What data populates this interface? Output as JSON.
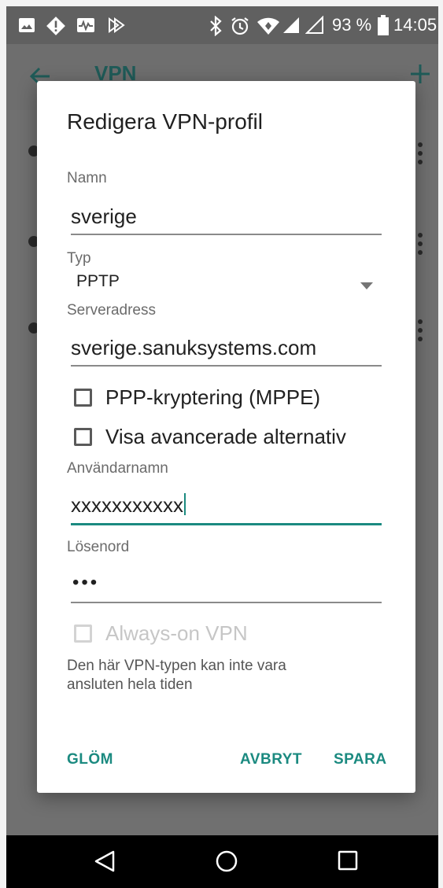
{
  "status_bar": {
    "battery_percent": "93 %",
    "time": "14:05",
    "icons": [
      "image-icon",
      "alert-icon",
      "activity-icon",
      "play-icon",
      "bluetooth-icon",
      "alarm-icon",
      "wifi-icon",
      "signal-icon",
      "signal-empty-icon",
      "battery-icon"
    ]
  },
  "app_bar": {
    "title": "VPN"
  },
  "dialog": {
    "title": "Redigera VPN-profil",
    "name_label": "Namn",
    "name_value": "sverige",
    "type_label": "Typ",
    "type_value": "PPTP",
    "server_label": "Serveradress",
    "server_value": "sverige.sanuksystems.com",
    "mppe_label": "PPP-kryptering (MPPE)",
    "mppe_checked": false,
    "advanced_label": "Visa avancerade alternativ",
    "advanced_checked": false,
    "username_label": "Användarnamn",
    "username_value": "xxxxxxxxxxx",
    "password_label": "Lösenord",
    "password_value": "•••",
    "always_on_label": "Always-on VPN",
    "always_on_checked": false,
    "always_on_helper": "Den här VPN-typen kan inte vara ansluten hela tiden",
    "buttons": {
      "forget": "GLÖM",
      "cancel": "AVBRYT",
      "save": "SPARA"
    }
  },
  "colors": {
    "accent": "#1b8a80",
    "statusbar": "#606060",
    "scrim": "#6e6e6e"
  }
}
